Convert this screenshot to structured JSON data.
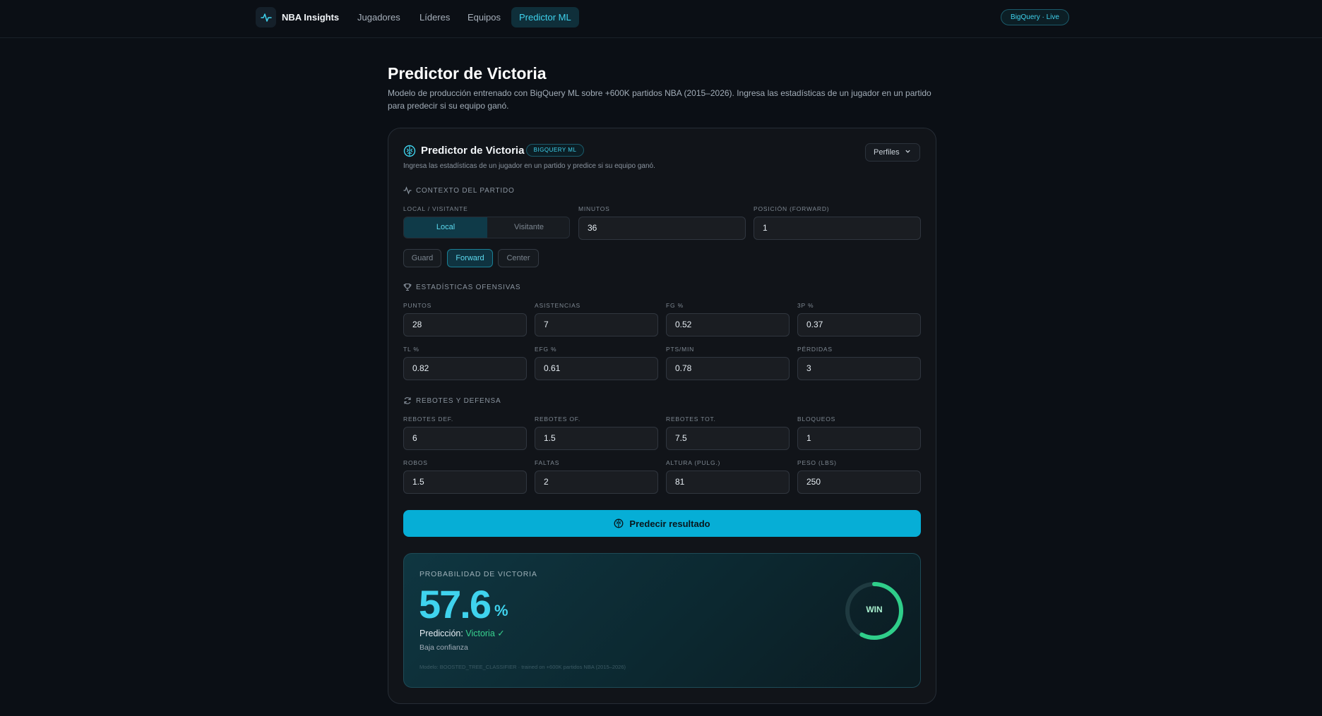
{
  "nav": {
    "brand": "NBA Insights",
    "items": [
      {
        "label": "Jugadores",
        "active": false
      },
      {
        "label": "Líderes",
        "active": false
      },
      {
        "label": "Equipos",
        "active": false
      },
      {
        "label": "Predictor ML",
        "active": true
      }
    ],
    "live_badge": "BigQuery · Live"
  },
  "header": {
    "title": "Predictor de Victoria",
    "description": "Modelo de producción entrenado con BigQuery ML sobre +600K partidos NBA (2015–2026). Ingresa las estadísticas de un jugador en un partido para predecir si su equipo ganó."
  },
  "card": {
    "title": "Predictor de Victoria",
    "badge": "BIGQUERY ML",
    "subtitle": "Ingresa las estadísticas de un jugador en un partido y predice si su equipo ganó.",
    "profiles_label": "Perfiles"
  },
  "context": {
    "section_title": "CONTEXTO DEL PARTIDO",
    "home_away_label": "LOCAL / VISITANTE",
    "home_label": "Local",
    "away_label": "Visitante",
    "selected": "Local",
    "minutes_label": "MINUTOS",
    "minutes_value": "36",
    "position_label": "POSICIÓN (FORWARD)",
    "position_value": "1",
    "positions": [
      "Guard",
      "Forward",
      "Center"
    ],
    "selected_position": "Forward"
  },
  "offense": {
    "section_title": "ESTADÍSTICAS OFENSIVAS",
    "fields": [
      {
        "label": "PUNTOS",
        "value": "28"
      },
      {
        "label": "ASISTENCIAS",
        "value": "7"
      },
      {
        "label": "FG %",
        "value": "0.52"
      },
      {
        "label": "3P %",
        "value": "0.37"
      },
      {
        "label": "TL %",
        "value": "0.82"
      },
      {
        "label": "EFG %",
        "value": "0.61"
      },
      {
        "label": "PTS/MIN",
        "value": "0.78"
      },
      {
        "label": "PÉRDIDAS",
        "value": "3"
      }
    ]
  },
  "defense": {
    "section_title": "REBOTES Y DEFENSA",
    "fields": [
      {
        "label": "REBOTES DEF.",
        "value": "6"
      },
      {
        "label": "REBOTES OF.",
        "value": "1.5"
      },
      {
        "label": "REBOTES TOT.",
        "value": "7.5"
      },
      {
        "label": "BLOQUEOS",
        "value": "1"
      },
      {
        "label": "ROBOS",
        "value": "1.5"
      },
      {
        "label": "FALTAS",
        "value": "2"
      },
      {
        "label": "ALTURA (PULG.)",
        "value": "81"
      },
      {
        "label": "PESO (LBS)",
        "value": "250"
      }
    ]
  },
  "predict_button": "Predecir resultado",
  "result": {
    "label": "PROBABILIDAD DE VICTORIA",
    "value": "57.6",
    "unit": "%",
    "prediction_label": "Predicción:",
    "prediction_value": "Victoria ✓",
    "confidence": "Baja confianza",
    "model_note": "Modelo: BOOSTED_TREE_CLASSIFIER · trained on +600K partidos NBA (2015–2026)",
    "ring_label": "WIN",
    "probability": 0.576
  },
  "colors": {
    "accent": "#06aed6",
    "accent_text": "#3fd3ee",
    "win": "#38d28f",
    "background": "#0b0f15"
  }
}
